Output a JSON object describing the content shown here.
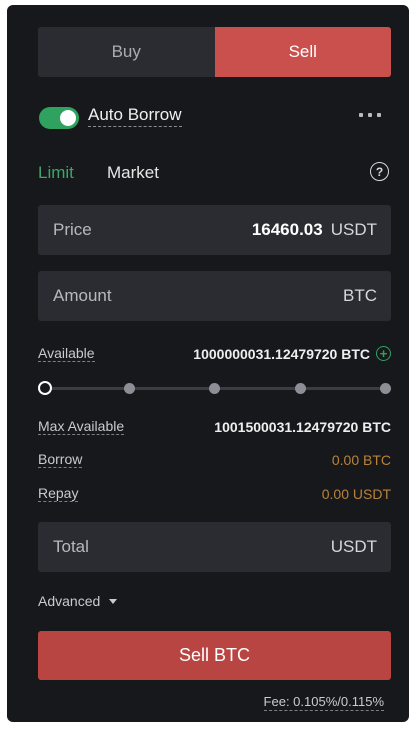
{
  "side_tabs": {
    "buy": "Buy",
    "sell": "Sell",
    "active": "sell"
  },
  "auto_borrow": {
    "label": "Auto Borrow",
    "enabled": true
  },
  "order_types": {
    "limit": "Limit",
    "market": "Market",
    "active": "limit"
  },
  "price_field": {
    "label": "Price",
    "value": "16460.03",
    "unit": "USDT"
  },
  "amount_field": {
    "label": "Amount",
    "value": "",
    "unit": "BTC"
  },
  "available": {
    "label": "Available",
    "value": "1000000031.12479720 BTC"
  },
  "slider": {
    "percent": 0,
    "stops": [
      0,
      25,
      50,
      75,
      100
    ]
  },
  "max_available": {
    "label": "Max Available",
    "value": "1001500031.12479720 BTC"
  },
  "borrow": {
    "label": "Borrow",
    "value": "0.00 BTC"
  },
  "repay": {
    "label": "Repay",
    "value": "0.00 USDT"
  },
  "total_field": {
    "label": "Total",
    "unit": "USDT"
  },
  "advanced": {
    "label": "Advanced"
  },
  "submit": {
    "label": "Sell BTC"
  },
  "fee": {
    "text": "Fee: 0.105%/0.115%"
  },
  "colors": {
    "accent_green": "#2fa25f",
    "sell_red": "#c9504d",
    "warning_orange": "#b8823a"
  }
}
